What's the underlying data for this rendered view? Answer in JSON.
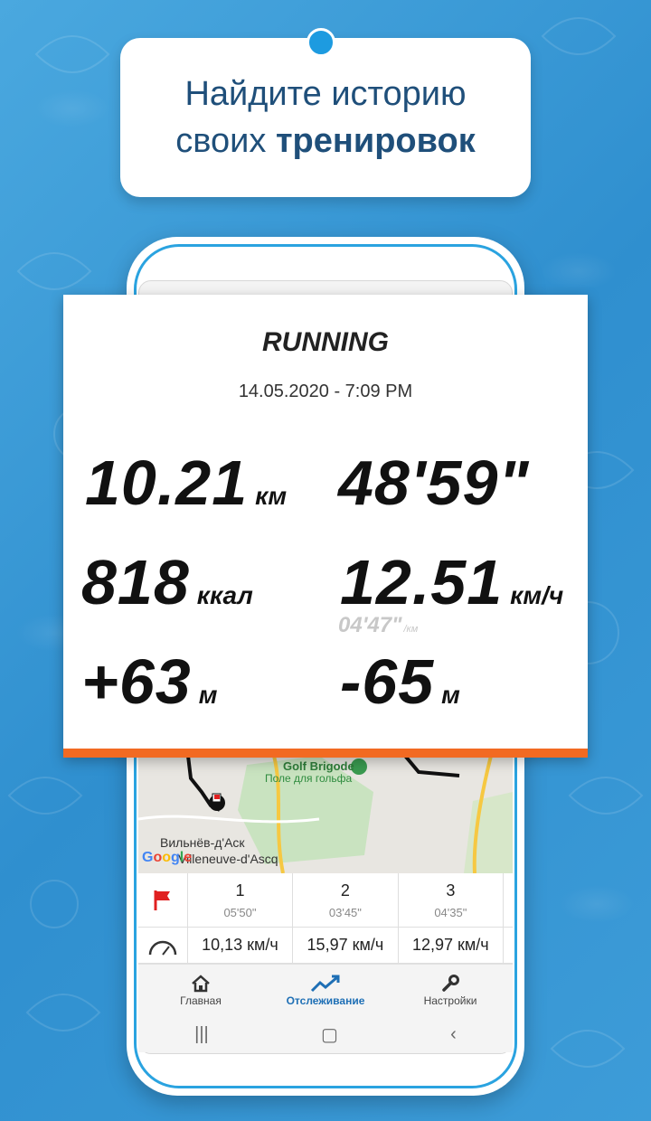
{
  "headline": {
    "line1": "Найдите историю",
    "line2_regular": "своих ",
    "line2_bold": "тренировок"
  },
  "activity": {
    "title": "RUNNING",
    "date": "14.05.2020 - 7:09 PM",
    "distance": {
      "value": "10.21",
      "unit": "км"
    },
    "duration": {
      "value": "48'59\""
    },
    "calories": {
      "value": "818",
      "unit": "ккал"
    },
    "speed": {
      "value": "12.51",
      "unit": "км/ч"
    },
    "pace": {
      "value": "04'47\"",
      "unit": "/км"
    },
    "ascent": {
      "value": "+63",
      "unit": "м"
    },
    "descent": {
      "value": "-65",
      "unit": "м"
    }
  },
  "map": {
    "poi_name": "Golf Brigode",
    "poi_sub": "Поле для гольфа",
    "town_ru": "Вильнёв-д'Аск",
    "town_fr": "Villeneuve-d'Ascq",
    "logo": "Google"
  },
  "laps": [
    {
      "num": "1",
      "time": "05'50\"",
      "speed": "10,13 км/ч"
    },
    {
      "num": "2",
      "time": "03'45\"",
      "speed": "15,97 км/ч"
    },
    {
      "num": "3",
      "time": "04'35\"",
      "speed": "12,97 км/ч"
    }
  ],
  "nav": {
    "home": "Главная",
    "tracking": "Отслеживание",
    "settings": "Настройки"
  },
  "system_nav": {
    "recents": "|||",
    "home": "▢",
    "back": "‹"
  },
  "colors": {
    "accent": "#f26a22",
    "brand_blue": "#1e6fb5",
    "background": "#3a9ad6"
  }
}
